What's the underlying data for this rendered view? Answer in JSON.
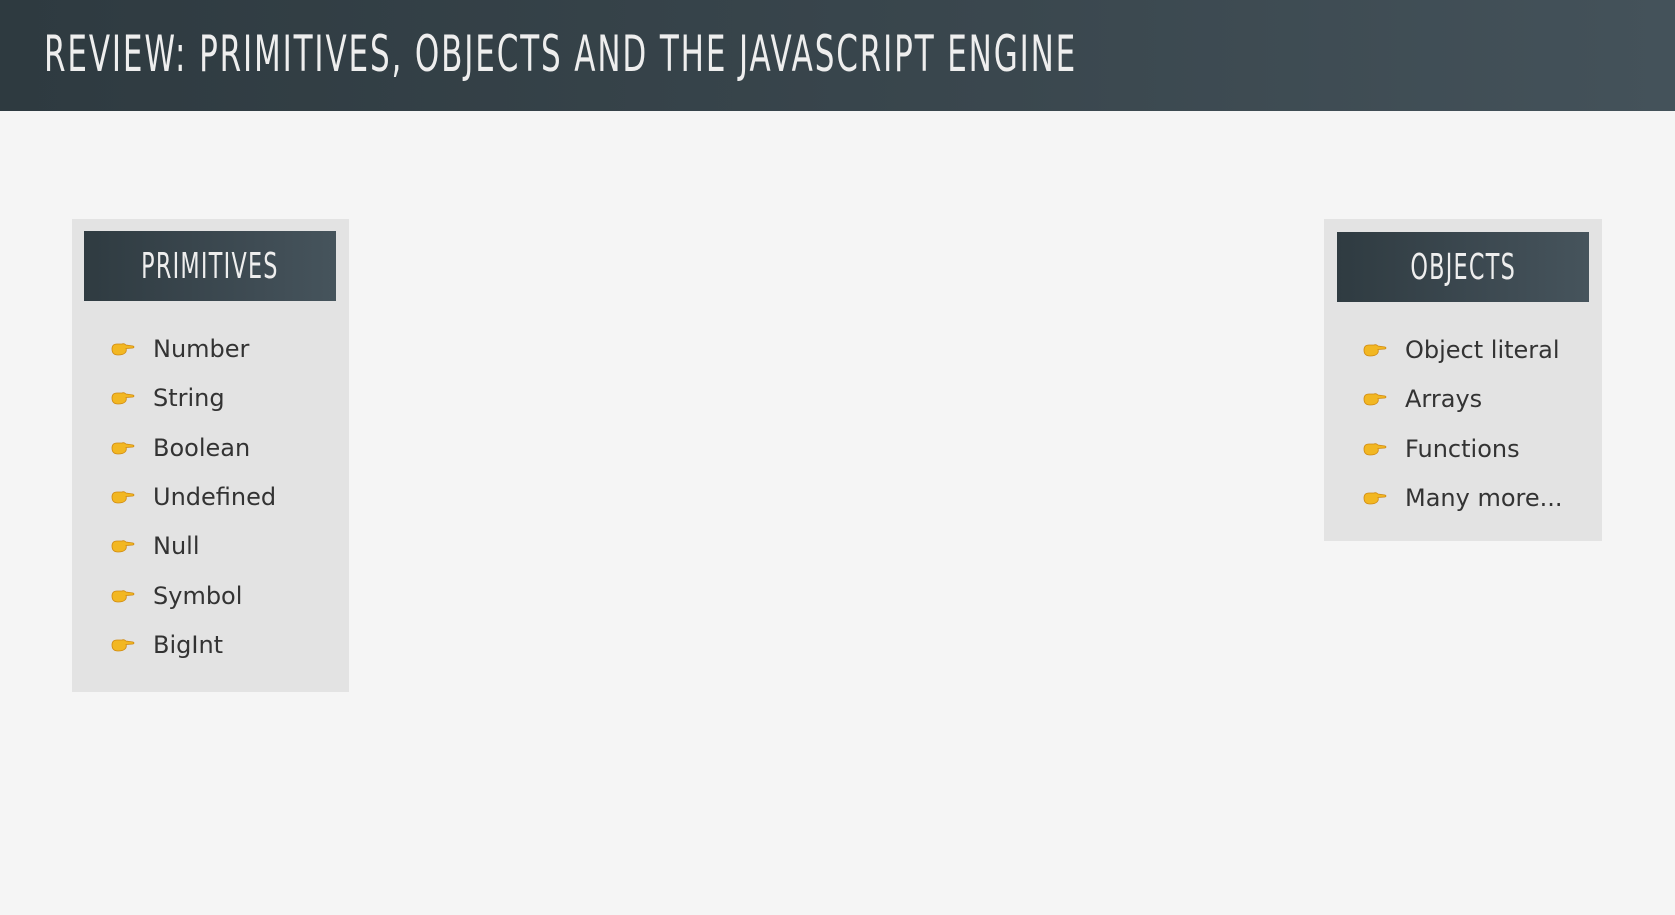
{
  "header": {
    "title": "REVIEW: PRIMITIVES, OBJECTS AND THE JAVASCRIPT ENGINE"
  },
  "primitives": {
    "title": "PRIMITIVES",
    "items": [
      "Number",
      "String",
      "Boolean",
      "Undefined",
      "Null",
      "Symbol",
      "BigInt"
    ]
  },
  "objects": {
    "title": "OBJECTS",
    "items": [
      "Object literal",
      "Arrays",
      "Functions",
      "Many more..."
    ]
  },
  "icons": {
    "bullet": "pointing-hand-icon"
  },
  "colors": {
    "header_bg": "#36434a",
    "panel_bg": "#e3e3e3",
    "bullet": "#f2b722"
  }
}
